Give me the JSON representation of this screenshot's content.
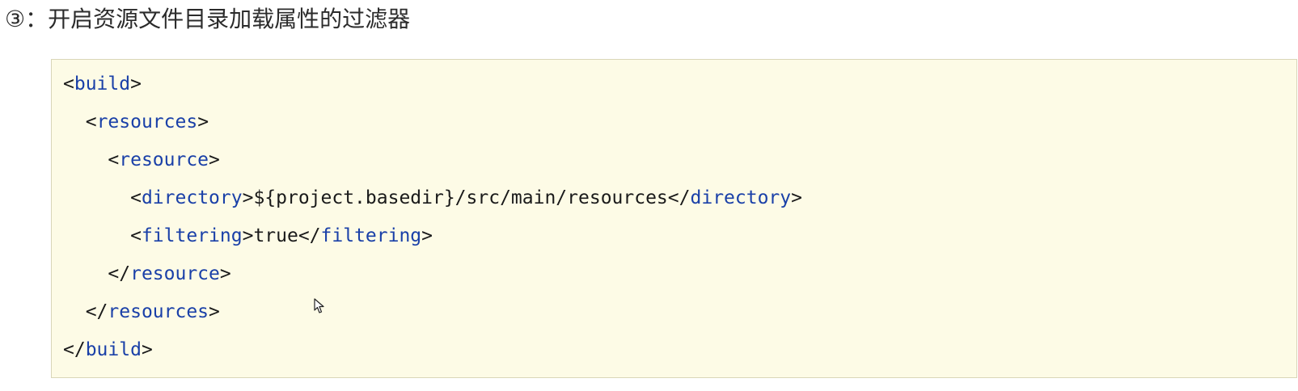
{
  "heading": "③：开启资源文件目录加载属性的过滤器",
  "code": {
    "lines": [
      {
        "indent": "",
        "open": "<",
        "tag": "build",
        "close": ">",
        "text": "",
        "end_open": "",
        "end_tag": "",
        "end_close": ""
      },
      {
        "indent": "  ",
        "open": "<",
        "tag": "resources",
        "close": ">",
        "text": "",
        "end_open": "",
        "end_tag": "",
        "end_close": ""
      },
      {
        "indent": "    ",
        "open": "<",
        "tag": "resource",
        "close": ">",
        "text": "",
        "end_open": "",
        "end_tag": "",
        "end_close": ""
      },
      {
        "indent": "      ",
        "open": "<",
        "tag": "directory",
        "close": ">",
        "text": "${project.basedir}/src/main/resources",
        "end_open": "</",
        "end_tag": "directory",
        "end_close": ">"
      },
      {
        "indent": "      ",
        "open": "<",
        "tag": "filtering",
        "close": ">",
        "text": "true",
        "end_open": "</",
        "end_tag": "filtering",
        "end_close": ">"
      },
      {
        "indent": "    ",
        "open": "</",
        "tag": "resource",
        "close": ">",
        "text": "",
        "end_open": "",
        "end_tag": "",
        "end_close": ""
      },
      {
        "indent": "  ",
        "open": "</",
        "tag": "resources",
        "close": ">",
        "text": "",
        "end_open": "",
        "end_tag": "",
        "end_close": ""
      },
      {
        "indent": "",
        "open": "</",
        "tag": "build",
        "close": ">",
        "text": "",
        "end_open": "",
        "end_tag": "",
        "end_close": ""
      }
    ]
  },
  "colors": {
    "tag": "#1a40a8",
    "text": "#1a1a1a",
    "code_background": "#fdfbe6",
    "code_border": "#d9d6b8"
  },
  "icons": {
    "cursor": "mouse-pointer-icon"
  }
}
